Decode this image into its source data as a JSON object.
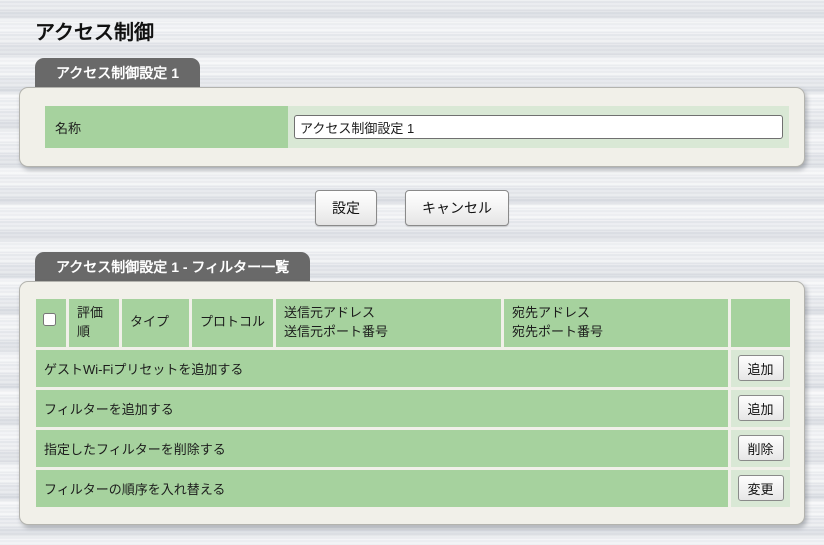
{
  "page": {
    "title": "アクセス制御"
  },
  "colors": {
    "header_green": "#a6d29e",
    "pale_green": "#d9e8d5",
    "panel_cream": "#f1f0e9",
    "tab_gray": "#696969",
    "background_metal": "#eceef1"
  },
  "section1": {
    "tab": "アクセス制御設定 1",
    "name_row": {
      "label": "名称",
      "value": "アクセス制御設定 1"
    }
  },
  "actions": {
    "submit": "設定",
    "cancel": "キャンセル"
  },
  "section2": {
    "tab": "アクセス制御設定 1 - フィルター一覧",
    "table": {
      "headers": {
        "order": "評価順",
        "type": "タイプ",
        "protocol": "プロトコル",
        "source_line1": "送信元アドレス",
        "source_line2": "送信元ポート番号",
        "dest_line1": "宛先アドレス",
        "dest_line2": "宛先ポート番号"
      },
      "rows": [
        {
          "label": "ゲストWi-Fiプリセットを追加する",
          "button": "追加"
        },
        {
          "label": "フィルターを追加する",
          "button": "追加"
        },
        {
          "label": "指定したフィルターを削除する",
          "button": "削除"
        },
        {
          "label": "フィルターの順序を入れ替える",
          "button": "変更"
        }
      ]
    }
  }
}
